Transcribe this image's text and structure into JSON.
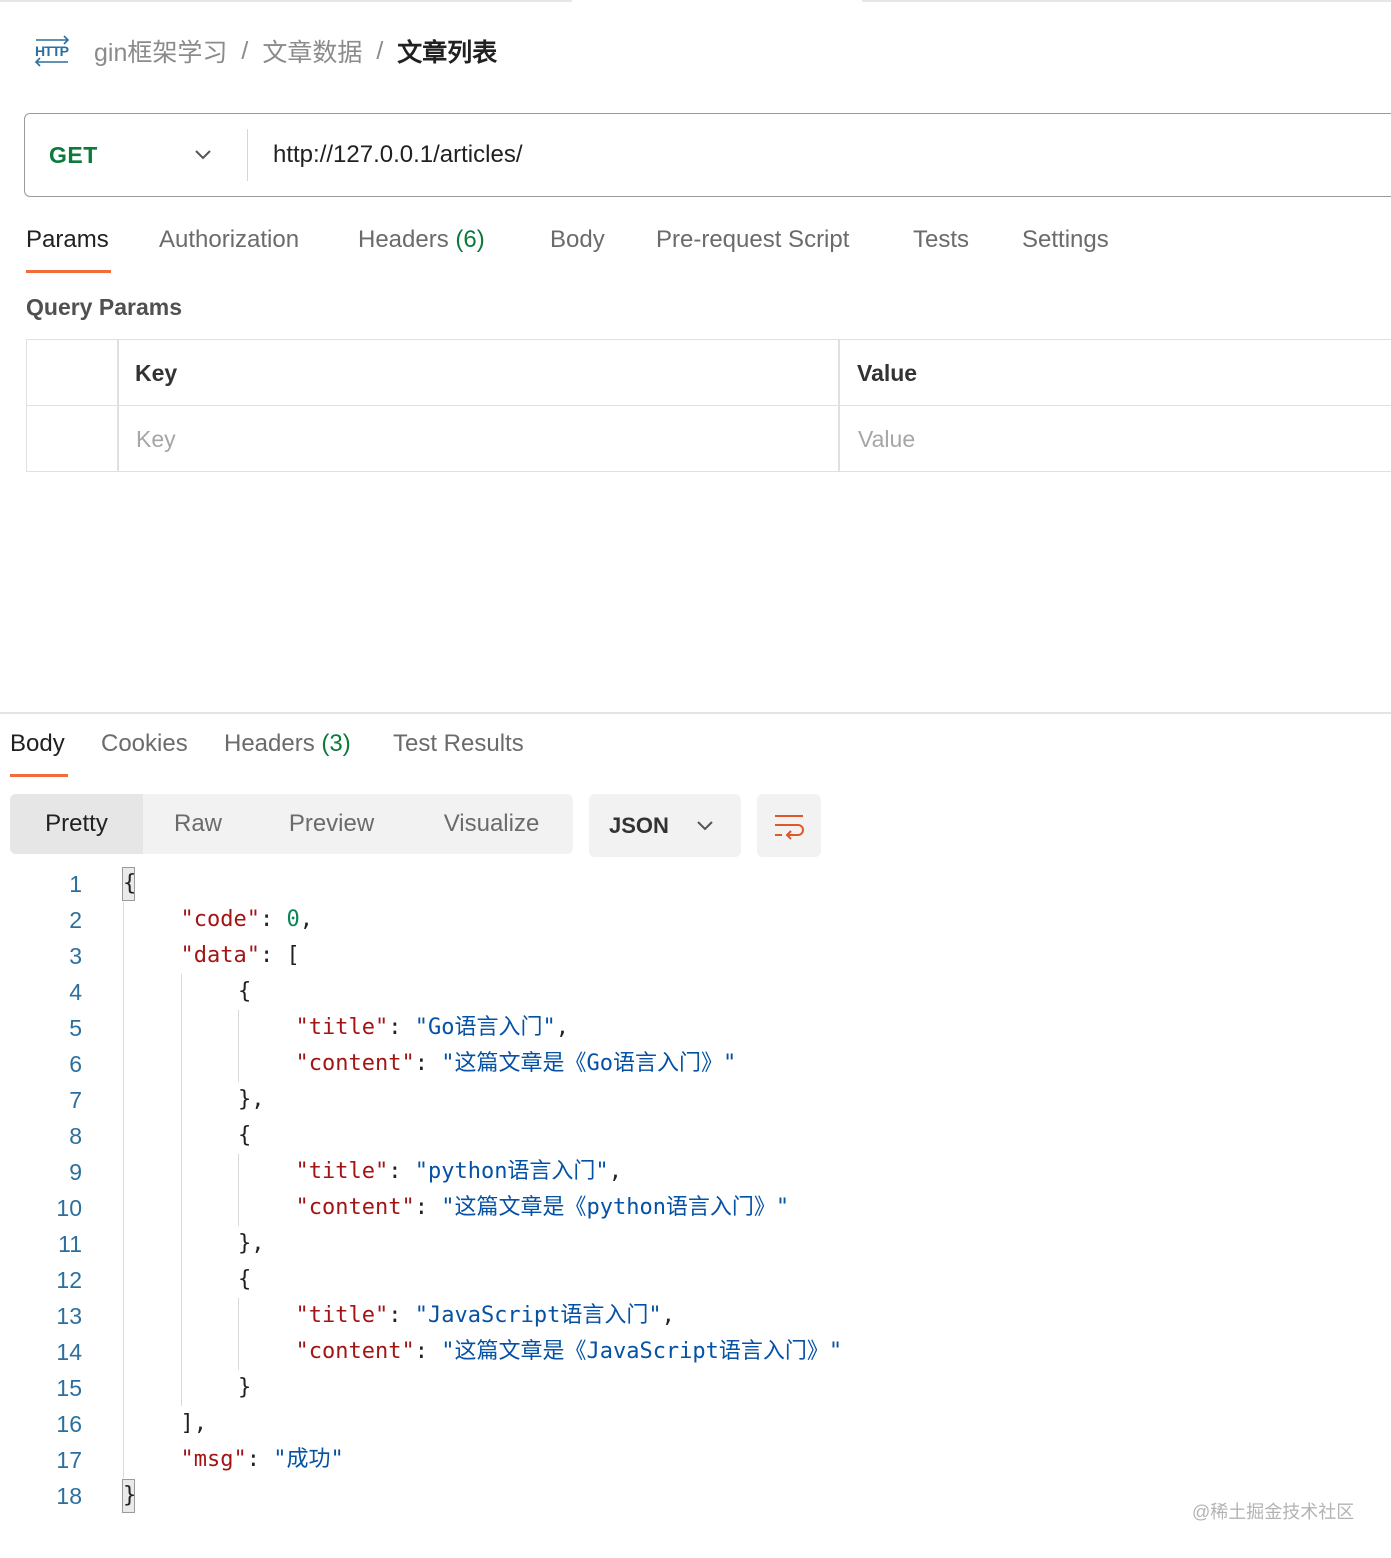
{
  "breadcrumb": {
    "icon": "http-icon",
    "items": [
      "gin框架学习",
      "文章数据"
    ],
    "separator": "/",
    "current": "文章列表"
  },
  "request": {
    "method": "GET",
    "url": "http://127.0.0.1/articles/"
  },
  "request_tabs": [
    {
      "label": "Params",
      "count": "",
      "active": true
    },
    {
      "label": "Authorization",
      "count": "",
      "active": false
    },
    {
      "label": "Headers",
      "count": "(6)",
      "active": false
    },
    {
      "label": "Body",
      "count": "",
      "active": false
    },
    {
      "label": "Pre-request Script",
      "count": "",
      "active": false
    },
    {
      "label": "Tests",
      "count": "",
      "active": false
    },
    {
      "label": "Settings",
      "count": "",
      "active": false
    }
  ],
  "query_params": {
    "title": "Query Params",
    "columns": [
      "Key",
      "Value"
    ],
    "placeholders": {
      "key": "Key",
      "value": "Value"
    }
  },
  "response_tabs": [
    {
      "label": "Body",
      "count": "",
      "active": true
    },
    {
      "label": "Cookies",
      "count": "",
      "active": false
    },
    {
      "label": "Headers",
      "count": "(3)",
      "active": false
    },
    {
      "label": "Test Results",
      "count": "",
      "active": false
    }
  ],
  "view_modes": [
    "Pretty",
    "Raw",
    "Preview",
    "Visualize"
  ],
  "active_view": "Pretty",
  "format": "JSON",
  "code_lines": [
    {
      "n": "1",
      "indent": 0,
      "tokens": [
        [
          "p",
          "{"
        ]
      ]
    },
    {
      "n": "2",
      "indent": 1,
      "tokens": [
        [
          "k",
          "\"code\""
        ],
        [
          "p",
          ": "
        ],
        [
          "n",
          "0"
        ],
        [
          "p",
          ","
        ]
      ]
    },
    {
      "n": "3",
      "indent": 1,
      "tokens": [
        [
          "k",
          "\"data\""
        ],
        [
          "p",
          ": ["
        ]
      ]
    },
    {
      "n": "4",
      "indent": 2,
      "tokens": [
        [
          "p",
          "{"
        ]
      ]
    },
    {
      "n": "5",
      "indent": 3,
      "tokens": [
        [
          "k",
          "\"title\""
        ],
        [
          "p",
          ": "
        ],
        [
          "s",
          "\"Go语言入门\""
        ],
        [
          "p",
          ","
        ]
      ]
    },
    {
      "n": "6",
      "indent": 3,
      "tokens": [
        [
          "k",
          "\"content\""
        ],
        [
          "p",
          ": "
        ],
        [
          "s",
          "\"这篇文章是《Go语言入门》\""
        ]
      ]
    },
    {
      "n": "7",
      "indent": 2,
      "tokens": [
        [
          "p",
          "},"
        ]
      ]
    },
    {
      "n": "8",
      "indent": 2,
      "tokens": [
        [
          "p",
          "{"
        ]
      ]
    },
    {
      "n": "9",
      "indent": 3,
      "tokens": [
        [
          "k",
          "\"title\""
        ],
        [
          "p",
          ": "
        ],
        [
          "s",
          "\"python语言入门\""
        ],
        [
          "p",
          ","
        ]
      ]
    },
    {
      "n": "10",
      "indent": 3,
      "tokens": [
        [
          "k",
          "\"content\""
        ],
        [
          "p",
          ": "
        ],
        [
          "s",
          "\"这篇文章是《python语言入门》\""
        ]
      ]
    },
    {
      "n": "11",
      "indent": 2,
      "tokens": [
        [
          "p",
          "},"
        ]
      ]
    },
    {
      "n": "12",
      "indent": 2,
      "tokens": [
        [
          "p",
          "{"
        ]
      ]
    },
    {
      "n": "13",
      "indent": 3,
      "tokens": [
        [
          "k",
          "\"title\""
        ],
        [
          "p",
          ": "
        ],
        [
          "s",
          "\"JavaScript语言入门\""
        ],
        [
          "p",
          ","
        ]
      ]
    },
    {
      "n": "14",
      "indent": 3,
      "tokens": [
        [
          "k",
          "\"content\""
        ],
        [
          "p",
          ": "
        ],
        [
          "s",
          "\"这篇文章是《JavaScript语言入门》\""
        ]
      ]
    },
    {
      "n": "15",
      "indent": 2,
      "tokens": [
        [
          "p",
          "}"
        ]
      ]
    },
    {
      "n": "16",
      "indent": 1,
      "tokens": [
        [
          "p",
          "],"
        ]
      ]
    },
    {
      "n": "17",
      "indent": 1,
      "tokens": [
        [
          "k",
          "\"msg\""
        ],
        [
          "p",
          ": "
        ],
        [
          "s",
          "\"成功\""
        ]
      ]
    },
    {
      "n": "18",
      "indent": 0,
      "tokens": [
        [
          "p",
          "}"
        ]
      ]
    }
  ],
  "watermark": "@稀土掘金技术社区",
  "colors": {
    "accent": "#f26b3a",
    "method_get": "#0b7a3c",
    "json_key": "#a31515",
    "json_string": "#0451a5",
    "json_number": "#098658",
    "line_number": "#2c6f9e"
  }
}
